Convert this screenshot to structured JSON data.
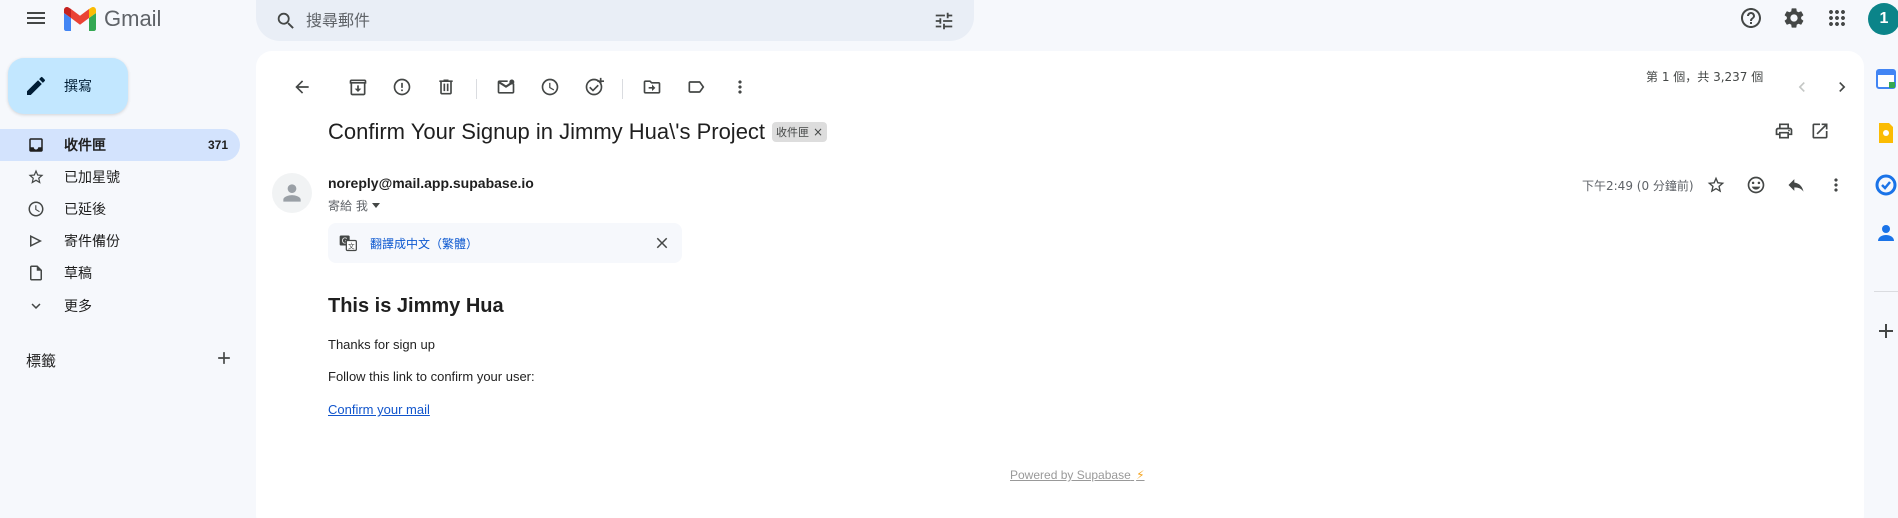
{
  "app": {
    "name": "Gmail"
  },
  "header": {
    "search_placeholder": "搜尋郵件",
    "avatar_initial": "1"
  },
  "sidebar": {
    "compose_label": "撰寫",
    "items": [
      {
        "label": "收件匣",
        "count": "371",
        "icon": "inbox-icon",
        "active": true
      },
      {
        "label": "已加星號",
        "count": "",
        "icon": "star-icon"
      },
      {
        "label": "已延後",
        "count": "",
        "icon": "clock-icon"
      },
      {
        "label": "寄件備份",
        "count": "",
        "icon": "send-icon"
      },
      {
        "label": "草稿",
        "count": "",
        "icon": "draft-icon"
      },
      {
        "label": "更多",
        "count": "",
        "icon": "chevron-down-icon"
      }
    ],
    "labels_heading": "標籤"
  },
  "toolbar": {
    "pager_text": "第 1 個，共 3,237 個"
  },
  "message": {
    "subject": "Confirm Your Signup in Jimmy Hua\\'s Project",
    "label_chip": "收件匣",
    "sender_email": "noreply@mail.app.supabase.io",
    "recipient": "寄給 我",
    "time": "下午2:49 (0 分鐘前)",
    "translate_link": "翻譯成中文（繁體）",
    "body_heading": "This is Jimmy Hua",
    "body_p1": "Thanks for sign up",
    "body_p2": "Follow this link to confirm your user:",
    "confirm_link": "Confirm your mail",
    "powered_by": "Powered by Supabase",
    "powered_icon": "⚡"
  },
  "colors": {
    "accent": "#0b57d0",
    "active_nav": "#d3e3fd",
    "compose_bg": "#c2e7ff",
    "avatar_bg": "#0b8489"
  }
}
